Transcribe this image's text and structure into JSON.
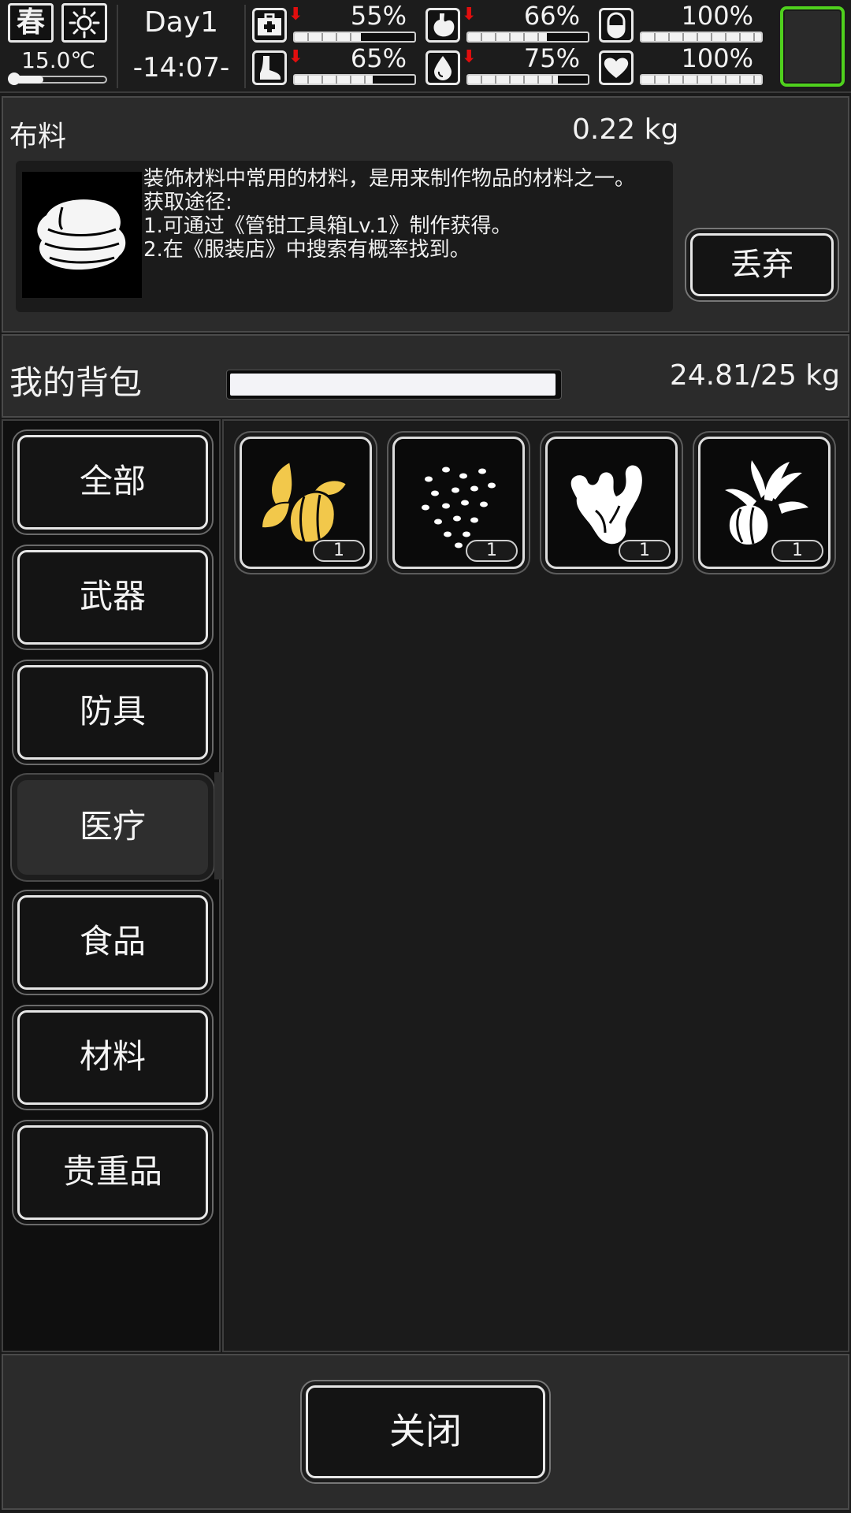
{
  "status": {
    "season": "春",
    "temperature": "15.0℃",
    "temperature_level": 0.3,
    "day": "Day1",
    "time": "-14:07-",
    "stats": [
      {
        "id": "health",
        "icon": "first-aid-kit-icon",
        "pct_text": "55%",
        "value": 0.55,
        "decreasing": true
      },
      {
        "id": "hunger",
        "icon": "stomach-icon",
        "pct_text": "66%",
        "value": 0.66,
        "decreasing": true
      },
      {
        "id": "sanity",
        "icon": "capsule-icon",
        "pct_text": "100%",
        "value": 1.0,
        "decreasing": false
      },
      {
        "id": "stamina",
        "icon": "foot-icon",
        "pct_text": "65%",
        "value": 0.65,
        "decreasing": true
      },
      {
        "id": "thirst",
        "icon": "water-drop-icon",
        "pct_text": "75%",
        "value": 0.75,
        "decreasing": true
      },
      {
        "id": "mood",
        "icon": "heart-icon",
        "pct_text": "100%",
        "value": 1.0,
        "decreasing": false
      }
    ],
    "down_arrow": "⬇"
  },
  "item": {
    "name": "布料",
    "weight": "0.22 kg",
    "description": [
      "装饰材料中常用的材料，是用来制作物品的材料之一。",
      "获取途径:",
      "1.可通过《管钳工具箱Lv.1》制作获得。",
      "2.在《服装店》中搜索有概率找到。"
    ],
    "discard_label": "丢弃"
  },
  "backpack": {
    "title": "我的背包",
    "weight": "24.81/25 kg",
    "fill": 0.9924
  },
  "categories": [
    {
      "label": "全部",
      "active": false
    },
    {
      "label": "武器",
      "active": false
    },
    {
      "label": "防具",
      "active": false
    },
    {
      "label": "医疗",
      "active": true
    },
    {
      "label": "食品",
      "active": false
    },
    {
      "label": "材料",
      "active": false
    },
    {
      "label": "贵重品",
      "active": false
    }
  ],
  "items": [
    {
      "icon": "herb-leaves-icon",
      "count": "1",
      "color": "#f2c84b"
    },
    {
      "icon": "seeds-icon",
      "count": "1",
      "color": "#ffffff"
    },
    {
      "icon": "ginger-root-icon",
      "count": "1",
      "color": "#ffffff"
    },
    {
      "icon": "garlic-bulb-icon",
      "count": "1",
      "color": "#ffffff"
    }
  ],
  "footer": {
    "close_label": "关闭"
  }
}
